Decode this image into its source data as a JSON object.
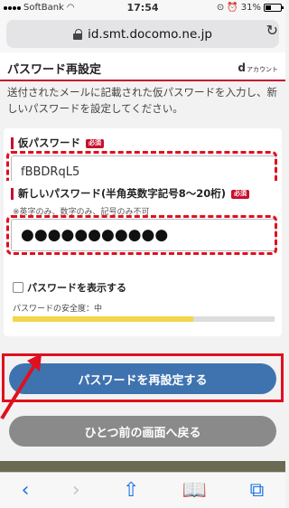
{
  "status": {
    "carrier": "SoftBank",
    "time": "17:54",
    "battery": "31%"
  },
  "browser": {
    "url": "id.smt.docomo.ne.jp"
  },
  "header": {
    "title": "パスワード再設定",
    "brand_d": "d",
    "brand": "アカウント"
  },
  "intro": "送付されたメールに記載された仮パスワードを入力し、新しいパスワードを設定してください。",
  "temp_password": {
    "label": "仮パスワード",
    "required": "必須",
    "value": "fBBDRqL5"
  },
  "new_password": {
    "label": "新しいパスワード(半角英数字記号8〜20桁)",
    "required": "必須",
    "note": "※英字のみ、数字のみ、記号のみ不可",
    "value": "●●●●●●●●●●●",
    "show_label": "パスワードを表示する",
    "strength_label": "パスワードの安全度：中",
    "strength_level": 0.69
  },
  "buttons": {
    "reset": "パスワードを再設定する",
    "back": "ひとつ前の画面へ戻る"
  },
  "toolbar": {
    "back": "‹",
    "forward": "›",
    "share": "⇧",
    "bookmarks": "📖",
    "tabs": "⧉"
  },
  "colors": {
    "accent_red": "#c8102e",
    "primary_blue": "#3f73b0",
    "strength_yellow": "#f2d64b"
  }
}
